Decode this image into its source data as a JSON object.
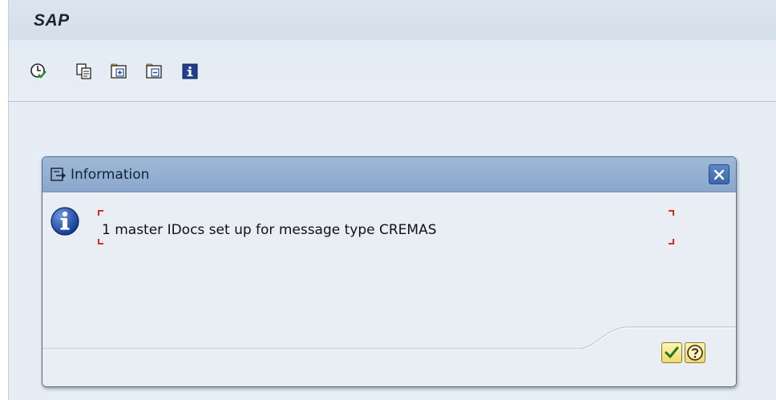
{
  "app": {
    "title": "SAP"
  },
  "toolbar": {
    "buttons": [
      {
        "name": "execute-icon"
      },
      {
        "name": "copy-icon"
      },
      {
        "name": "expand-icon"
      },
      {
        "name": "collapse-icon"
      },
      {
        "name": "info-icon"
      }
    ]
  },
  "dialog": {
    "title": "Information",
    "message": "1 master IDocs set up for message type CREMAS",
    "message_icon": "info-icon",
    "close_icon": "close-icon",
    "ok_icon": "checkmark-icon",
    "help_icon": "help-icon"
  },
  "colors": {
    "accent": "#3b67ad",
    "focus_marker": "#e0281c",
    "button_yellow": "#f2d96c"
  }
}
